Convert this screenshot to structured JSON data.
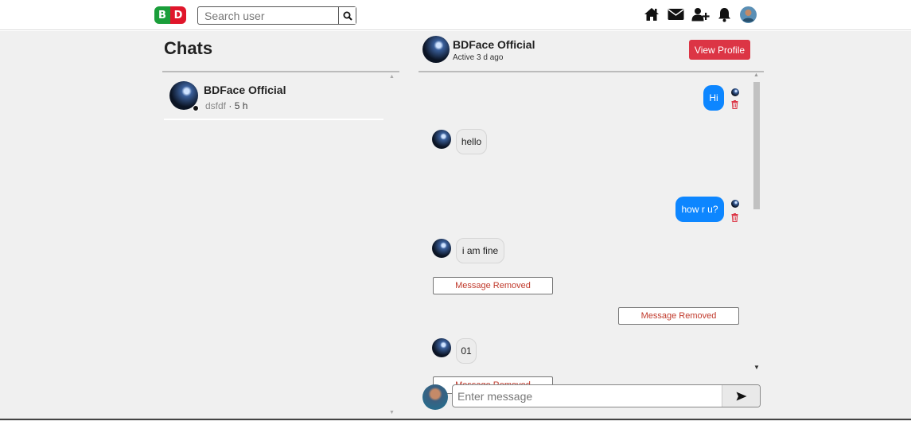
{
  "nav": {
    "logo_left": "B",
    "logo_right": "D",
    "search_placeholder": "Search user",
    "icons": [
      "home-icon",
      "envelope-icon",
      "user-plus-icon",
      "bell-icon",
      "avatar"
    ]
  },
  "left": {
    "title": "Chats",
    "chats": [
      {
        "name": "BDFace Official",
        "last_message": "dsfdf",
        "separator": "·",
        "time": "5 h",
        "online": true
      }
    ]
  },
  "conversation": {
    "name": "BDFace Official",
    "status": "Active 3 d ago",
    "view_profile_label": "View Profile",
    "messages": [
      {
        "from": "me",
        "text": "Hi"
      },
      {
        "from": "them",
        "text": "hello"
      },
      {
        "from": "me",
        "text": "how r u?"
      },
      {
        "from": "them",
        "text": "i am fine"
      },
      {
        "from": "them",
        "text": "Message Removed",
        "removed": true
      },
      {
        "from": "me",
        "text": "Message Removed",
        "removed": true
      },
      {
        "from": "them",
        "text": "01"
      },
      {
        "from": "them",
        "text": "Message Removed",
        "removed": true
      }
    ],
    "input_placeholder": "Enter message"
  },
  "colors": {
    "accent_blue": "#0d86ff",
    "danger_red": "#dc3545",
    "logo_green": "#1a9e3a",
    "logo_red": "#e0162b",
    "page_bg": "#f0f0f0"
  }
}
